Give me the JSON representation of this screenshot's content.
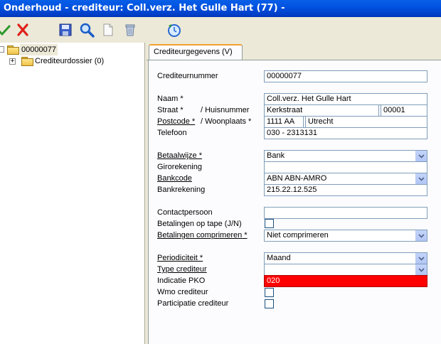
{
  "window": {
    "title": "Onderhoud - crediteur: Coll.verz. Het Gulle Hart (77) -"
  },
  "toolbar": {
    "buttons": [
      {
        "name": "confirm",
        "icon": "check-icon"
      },
      {
        "name": "cancel",
        "icon": "close-icon"
      },
      {
        "name": "save",
        "icon": "save-icon"
      },
      {
        "name": "search",
        "icon": "search-icon"
      },
      {
        "name": "new",
        "icon": "document-icon"
      },
      {
        "name": "delete",
        "icon": "trash-icon"
      },
      {
        "name": "refresh",
        "icon": "refresh-icon"
      }
    ]
  },
  "tree": {
    "root": {
      "label": "00000077"
    },
    "child": {
      "expander": "+",
      "label": "Crediteurdossier (0)"
    }
  },
  "tab": {
    "label": "Crediteurgegevens (V)"
  },
  "form": {
    "crediteurnummer": {
      "label": "Crediteurnummer",
      "value": "00000077"
    },
    "naam": {
      "label": "Naam *",
      "value": "Coll.verz. Het Gulle Hart"
    },
    "straat": {
      "label": "Straat *",
      "label2": "/ Huisnummer",
      "value": "Kerkstraat",
      "number": "00001"
    },
    "postcode": {
      "label": "Postcode *",
      "label2": "/ Woonplaats *",
      "value": "1111 AA",
      "city": "Utrecht"
    },
    "telefoon": {
      "label": "Telefoon",
      "value": "030 - 2313131"
    },
    "betaalwijze": {
      "label": "Betaalwijze *",
      "value": "Bank"
    },
    "girorekening": {
      "label": "Girorekening",
      "value": ""
    },
    "bankcode": {
      "label": "Bankcode",
      "value": "ABN ABN-AMRO"
    },
    "bankrekening": {
      "label": "Bankrekening",
      "value": "215.22.12.525"
    },
    "contactpersoon": {
      "label": "Contactpersoon",
      "value": ""
    },
    "betalingen_tape": {
      "label": "Betalingen op tape (J/N)",
      "checked": false
    },
    "betalingen_comprimeren": {
      "label": "Betalingen comprimeren *",
      "value": "Niet comprimeren"
    },
    "periodiciteit": {
      "label": "Periodiciteit *",
      "value": "Maand"
    },
    "type_crediteur": {
      "label": "Type crediteur",
      "value": ""
    },
    "indicatie_pko": {
      "label": "Indicatie PKO",
      "value": "020"
    },
    "wmo": {
      "label": "Wmo crediteur",
      "checked": false
    },
    "participatie": {
      "label": "Participatie crediteur",
      "checked": false
    }
  },
  "colors": {
    "title_bar": "#0053e0",
    "panel": "#ece9d8",
    "error_field": "#ff0000",
    "tab_accent": "#f0a030"
  }
}
